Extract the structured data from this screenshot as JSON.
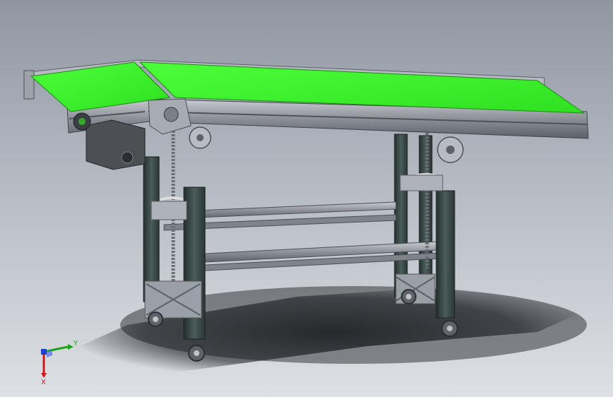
{
  "triad": {
    "y_label": "Y",
    "x_label": "X",
    "y_color": "#1aa61a",
    "x_color": "#d01818",
    "z_color": "#1e3fd0"
  },
  "colors": {
    "belt": "#3df72a",
    "frame": "#8c9097",
    "leg": "#3a4a48",
    "background_top": "#8f96a0",
    "background_bottom": "#dde0e4"
  }
}
